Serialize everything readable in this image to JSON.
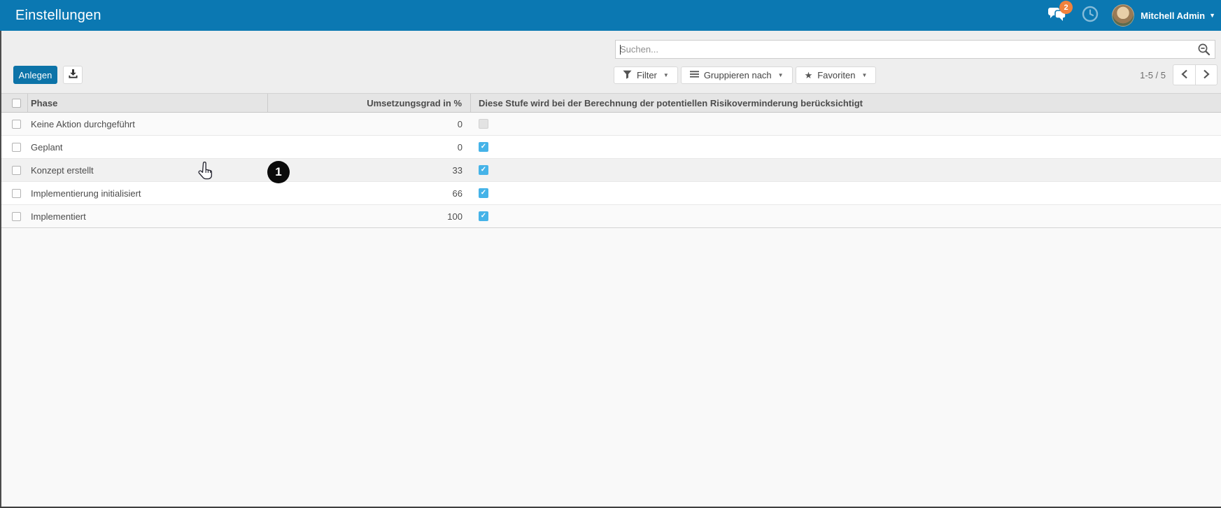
{
  "topbar": {
    "title": "Einstellungen",
    "messages_badge": "2",
    "user_name": "Mitchell Admin"
  },
  "control_panel": {
    "search_placeholder": "Suchen...",
    "create_button": "Anlegen",
    "filter_button": "Filter",
    "group_by_button": "Gruppieren nach",
    "favorites_button": "Favoriten",
    "pager_text": "1-5 / 5"
  },
  "table": {
    "columns": {
      "phase": "Phase",
      "grad": "Umsetzungsgrad in %",
      "risk": "Diese Stufe wird bei der Berechnung der potentiellen Risikoverminderung berücksichtigt"
    },
    "hover_row_index": 2,
    "rows": [
      {
        "phase": "Keine Aktion durchgeführt",
        "grad": "0",
        "risk_checked": false
      },
      {
        "phase": "Geplant",
        "grad": "0",
        "risk_checked": true
      },
      {
        "phase": "Konzept erstellt",
        "grad": "33",
        "risk_checked": true
      },
      {
        "phase": "Implementierung initialisiert",
        "grad": "66",
        "risk_checked": true
      },
      {
        "phase": "Implementiert",
        "grad": "100",
        "risk_checked": true
      }
    ]
  },
  "annotation": {
    "label": "1"
  },
  "colors": {
    "topbar_bg": "#0b78b2",
    "primary_button_bg": "#0c73a8",
    "checkbox_checked": "#45b3e8",
    "badge_bg": "#f0823d"
  }
}
